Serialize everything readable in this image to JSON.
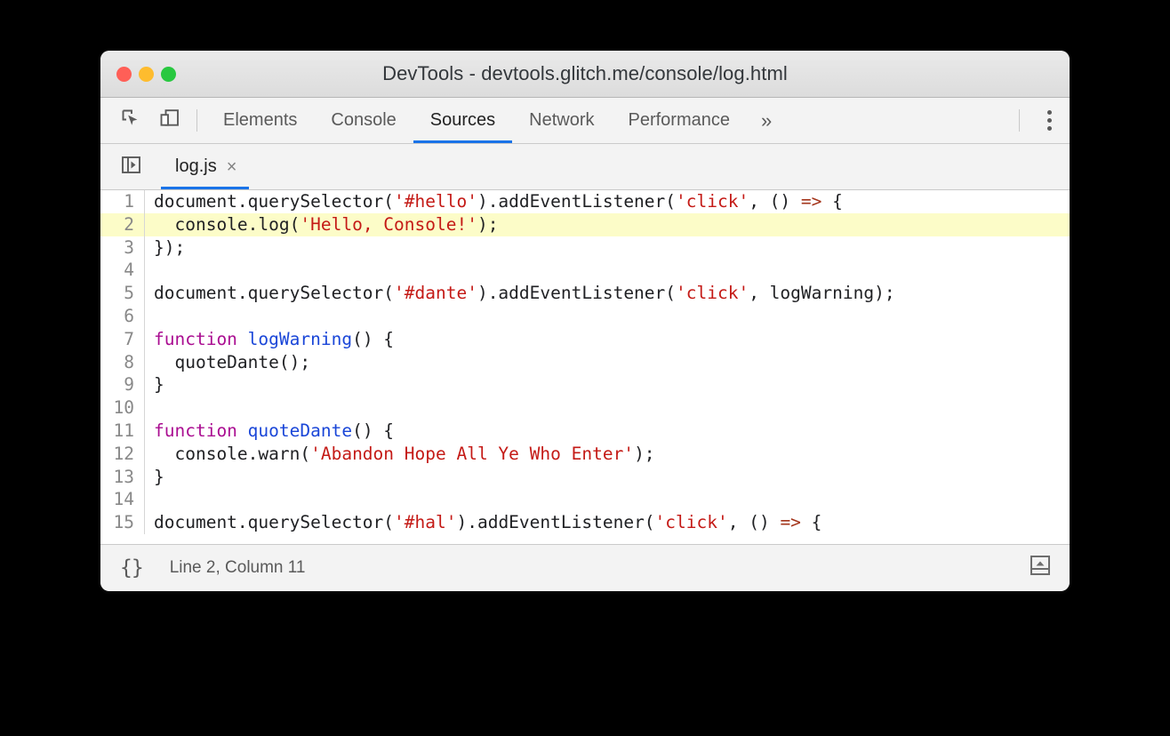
{
  "window": {
    "title": "DevTools - devtools.glitch.me/console/log.html",
    "controls": {
      "close": "close-window",
      "minimize": "minimize-window",
      "zoom": "zoom-window"
    }
  },
  "toolbar": {
    "inspect_icon": "inspect-element-icon",
    "device_icon": "device-toolbar-icon",
    "overflow_label": "»",
    "menu_icon": "more-options-icon"
  },
  "tabs": [
    {
      "label": "Elements",
      "active": false
    },
    {
      "label": "Console",
      "active": false
    },
    {
      "label": "Sources",
      "active": true
    },
    {
      "label": "Network",
      "active": false
    },
    {
      "label": "Performance",
      "active": false
    }
  ],
  "file_tabs": {
    "navigator_icon": "show-navigator-icon",
    "items": [
      {
        "name": "log.js",
        "close": "×",
        "active": true
      }
    ]
  },
  "editor": {
    "highlighted_line": 2,
    "lines": [
      {
        "n": "1",
        "tokens": [
          {
            "t": "document.querySelector(",
            "c": "plain"
          },
          {
            "t": "'#hello'",
            "c": "str"
          },
          {
            "t": ").addEventListener(",
            "c": "plain"
          },
          {
            "t": "'click'",
            "c": "str"
          },
          {
            "t": ", () ",
            "c": "plain"
          },
          {
            "t": "=>",
            "c": "arrow"
          },
          {
            "t": " {",
            "c": "plain"
          }
        ]
      },
      {
        "n": "2",
        "tokens": [
          {
            "t": "  console.log(",
            "c": "plain"
          },
          {
            "t": "'Hello, Console!'",
            "c": "str"
          },
          {
            "t": ");",
            "c": "plain"
          }
        ]
      },
      {
        "n": "3",
        "tokens": [
          {
            "t": "});",
            "c": "plain"
          }
        ]
      },
      {
        "n": "4",
        "tokens": [
          {
            "t": "",
            "c": "plain"
          }
        ]
      },
      {
        "n": "5",
        "tokens": [
          {
            "t": "document.querySelector(",
            "c": "plain"
          },
          {
            "t": "'#dante'",
            "c": "str"
          },
          {
            "t": ").addEventListener(",
            "c": "plain"
          },
          {
            "t": "'click'",
            "c": "str"
          },
          {
            "t": ", logWarning);",
            "c": "plain"
          }
        ]
      },
      {
        "n": "6",
        "tokens": [
          {
            "t": "",
            "c": "plain"
          }
        ]
      },
      {
        "n": "7",
        "tokens": [
          {
            "t": "function",
            "c": "kw"
          },
          {
            "t": " ",
            "c": "plain"
          },
          {
            "t": "logWarning",
            "c": "fn"
          },
          {
            "t": "() {",
            "c": "plain"
          }
        ]
      },
      {
        "n": "8",
        "tokens": [
          {
            "t": "  quoteDante();",
            "c": "plain"
          }
        ]
      },
      {
        "n": "9",
        "tokens": [
          {
            "t": "}",
            "c": "plain"
          }
        ]
      },
      {
        "n": "10",
        "tokens": [
          {
            "t": "",
            "c": "plain"
          }
        ]
      },
      {
        "n": "11",
        "tokens": [
          {
            "t": "function",
            "c": "kw"
          },
          {
            "t": " ",
            "c": "plain"
          },
          {
            "t": "quoteDante",
            "c": "fn"
          },
          {
            "t": "() {",
            "c": "plain"
          }
        ]
      },
      {
        "n": "12",
        "tokens": [
          {
            "t": "  console.warn(",
            "c": "plain"
          },
          {
            "t": "'Abandon Hope All Ye Who Enter'",
            "c": "str"
          },
          {
            "t": ");",
            "c": "plain"
          }
        ]
      },
      {
        "n": "13",
        "tokens": [
          {
            "t": "}",
            "c": "plain"
          }
        ]
      },
      {
        "n": "14",
        "tokens": [
          {
            "t": "",
            "c": "plain"
          }
        ]
      },
      {
        "n": "15",
        "tokens": [
          {
            "t": "document.querySelector(",
            "c": "plain"
          },
          {
            "t": "'#hal'",
            "c": "str"
          },
          {
            "t": ").addEventListener(",
            "c": "plain"
          },
          {
            "t": "'click'",
            "c": "str"
          },
          {
            "t": ", () ",
            "c": "plain"
          },
          {
            "t": "=>",
            "c": "arrow"
          },
          {
            "t": " {",
            "c": "plain"
          }
        ]
      }
    ]
  },
  "statusbar": {
    "pretty_print_label": "{}",
    "position": "Line 2, Column 11",
    "drawer_icon": "show-drawer-icon"
  },
  "colors": {
    "accent": "#1a73e8",
    "highlight_line": "#fcfcc8",
    "string": "#c41a16",
    "keyword": "#aa0d91",
    "function": "#1a46d8",
    "arrow": "#a3341a",
    "traffic_close": "#ff5f57",
    "traffic_minimize": "#febc2e",
    "traffic_zoom": "#28c840"
  }
}
